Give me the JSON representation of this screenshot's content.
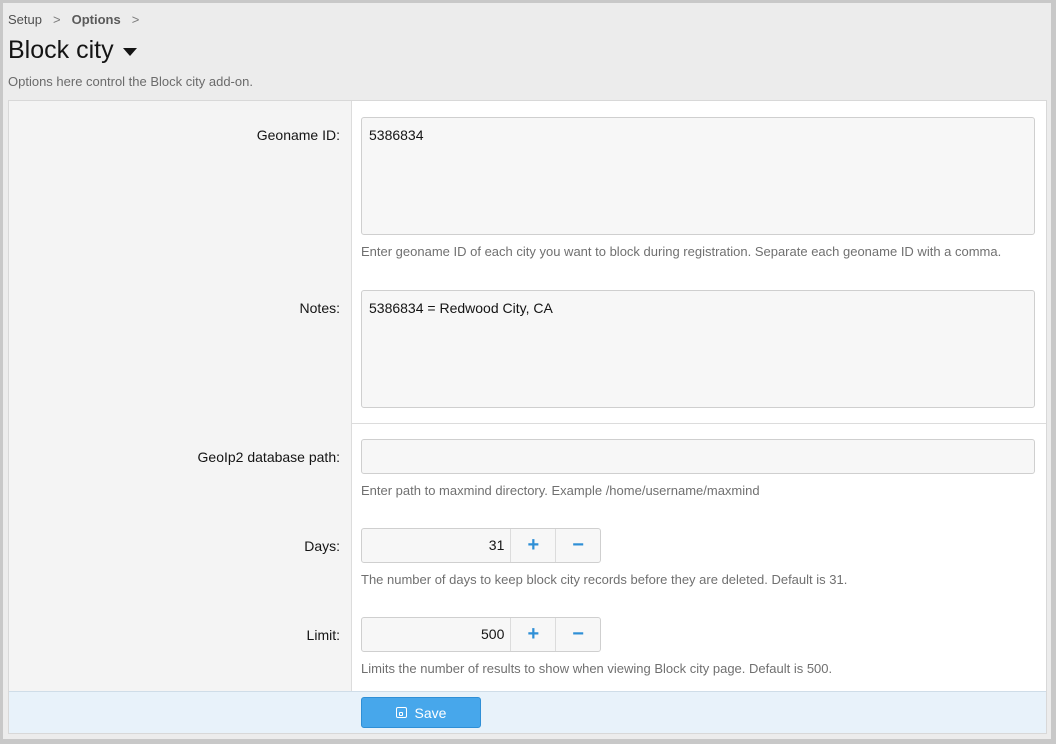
{
  "breadcrumb": {
    "items": [
      "Setup",
      "Options"
    ],
    "separator": ">"
  },
  "page": {
    "title": "Block city",
    "description": "Options here control the Block city add-on."
  },
  "options": {
    "geoname_id": {
      "label": "Geoname ID:",
      "value": "5386834",
      "hint": "Enter geoname ID of each city you want to block during registration. Separate each geoname ID with a comma."
    },
    "notes": {
      "label": "Notes:",
      "value": "5386834 = Redwood City, CA"
    },
    "geoip2_path": {
      "label": "GeoIp2 database path:",
      "value": "",
      "hint": "Enter path to maxmind directory. Example /home/username/maxmind"
    },
    "days": {
      "label": "Days:",
      "value": "31",
      "hint": "The number of days to keep block city records before they are deleted. Default is 31."
    },
    "limit": {
      "label": "Limit:",
      "value": "500",
      "hint": "Limits the number of results to show when viewing Block city page. Default is 500."
    }
  },
  "stepper": {
    "plus": "+",
    "minus": "−"
  },
  "footer": {
    "save_label": "Save"
  },
  "colors": {
    "accent": "#47a7eb",
    "footer_bg": "#e8f2fa"
  },
  "icons": {
    "title_caret": "caret-down-icon",
    "save": "save-icon",
    "crumb_sep": "chevron-right-icon"
  }
}
